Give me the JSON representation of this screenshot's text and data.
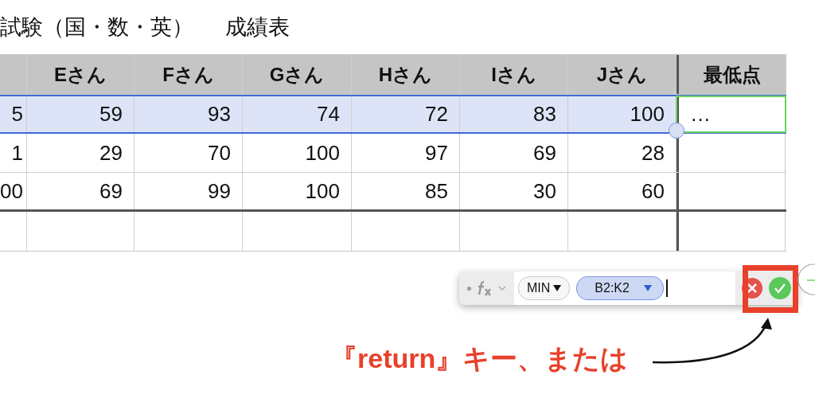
{
  "title": {
    "exam": "試験（国・数・英）",
    "sheet": "成績表"
  },
  "table": {
    "columns": [
      "Eさん",
      "Fさん",
      "Gさん",
      "Hさん",
      "Iさん",
      "Jさん",
      "最低点"
    ],
    "rows": [
      {
        "cut_value": "5",
        "values": [
          "59",
          "93",
          "74",
          "72",
          "83",
          "100"
        ],
        "min": "…",
        "selected": true,
        "active": true
      },
      {
        "cut_value": "1",
        "values": [
          "29",
          "70",
          "100",
          "97",
          "69",
          "28"
        ],
        "selected": false,
        "active": false
      },
      {
        "cut_value": "00",
        "values": [
          "69",
          "99",
          "100",
          "85",
          "30",
          "60"
        ],
        "selected": false,
        "active": false
      }
    ]
  },
  "formula_bar": {
    "function": "MIN",
    "range": "B2:K2"
  },
  "annotation": "『return』キー、または"
}
